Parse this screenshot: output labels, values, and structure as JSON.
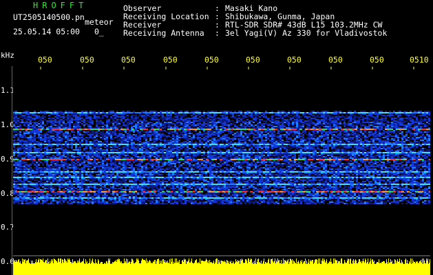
{
  "header": {
    "title": "HROFFT",
    "filename": "UT2505140500.pn",
    "meteor_label": "meteor",
    "datetime": "25.05.14 05:00",
    "truncated": "0_"
  },
  "info": {
    "rows": [
      {
        "label": "Observer",
        "value": "Masaki Kano"
      },
      {
        "label": "Receiving Location",
        "value": "Shibukawa, Gunma, Japan"
      },
      {
        "label": "Receiver",
        "value": "RTL-SDR SDR# 43dB L15 103.2MHz CW"
      },
      {
        "label": "Receiving Antenna",
        "value": "3el Yagi(V) Az 330 for Vladivostok"
      }
    ],
    "separator": ":"
  },
  "axes": {
    "y_unit": "kHz",
    "y_ticks": [
      "1.1",
      "1.0",
      "0.9",
      "0.8",
      "0.7",
      "0.6"
    ],
    "x_ticks": [
      "050",
      "050",
      "050",
      "050",
      "050",
      "050",
      "050",
      "050",
      "050",
      "0510"
    ]
  },
  "colors": {
    "background": "#000000",
    "title": "#2eea2e",
    "tick_labels": "#ffff40",
    "signal_band": "#1030c0",
    "strong_line": "#ff3030",
    "noise_floor": "#ffff00"
  }
}
